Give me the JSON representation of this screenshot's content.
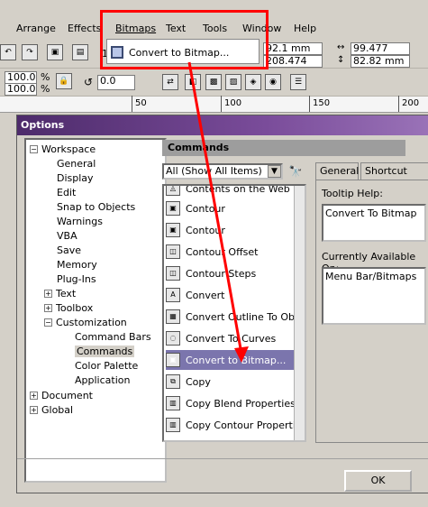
{
  "menubar": {
    "items": [
      "Arrange",
      "Effects",
      "Bitmaps",
      "Text",
      "Tools",
      "Window",
      "Help"
    ]
  },
  "bitmaps_menu": {
    "item_label": "Convert to Bitmap..."
  },
  "toolbar": {
    "pos_x": "92.1 mm",
    "pos_y": "208.474 mm",
    "width": "99.477 mm",
    "height": "82.82 mm",
    "scale_w": "100.0",
    "scale_h": "100.0",
    "percent": "%",
    "angle": "0.0",
    "prefix_1": "1"
  },
  "ruler": {
    "labels": [
      "50",
      "100",
      "150",
      "200"
    ]
  },
  "options": {
    "title": "Options",
    "tree": {
      "workspace": "Workspace",
      "children": [
        "General",
        "Display",
        "Edit",
        "Snap to Objects",
        "Warnings",
        "VBA",
        "Save",
        "Memory",
        "Plug-Ins",
        "Text",
        "Toolbox",
        "Customization"
      ],
      "customization_children": [
        "Command Bars",
        "Commands",
        "Color Palette",
        "Application"
      ],
      "document": "Document",
      "global": "Global"
    },
    "commands": {
      "title": "Commands",
      "filter": "All (Show All Items)",
      "list": [
        "Contents on the Web",
        "Contour",
        "Contour",
        "Contour Offset",
        "Contour Steps",
        "Convert",
        "Convert Outline To Object",
        "Convert To Curves",
        "Convert to Bitmap...",
        "Copy",
        "Copy Blend Properties",
        "Copy Contour Properties"
      ]
    },
    "tabs": [
      "General",
      "Shortcut Keys"
    ],
    "tooltip_label": "Tooltip Help:",
    "tooltip_value": "Convert To Bitmap",
    "available_label": "Currently Available On:",
    "available_value": "Menu Bar/Bitmaps",
    "ok_label": "OK"
  },
  "colors": {
    "highlight": "#ff0000",
    "selection": "#7b75ad",
    "titlebar": "#4d2b6b"
  }
}
